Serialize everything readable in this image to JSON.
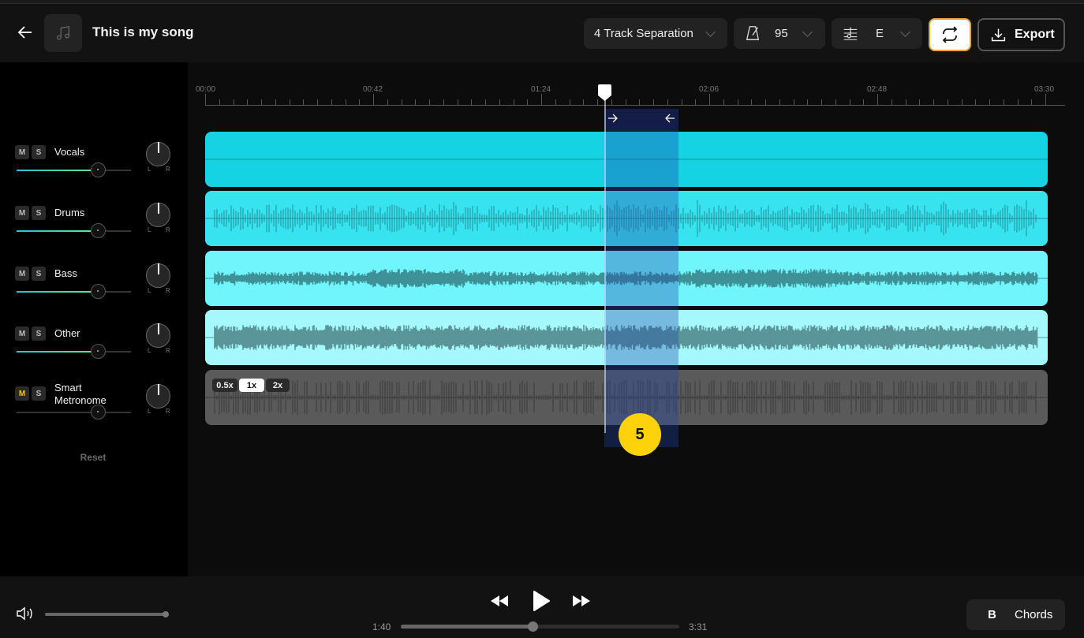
{
  "header": {
    "title": "This is my song",
    "separation": "4 Track Separation",
    "tempo": "95",
    "key": "E",
    "export_label": "Export"
  },
  "tracks": [
    {
      "name": "Vocals",
      "mute": "M",
      "solo": "S",
      "muted": false,
      "volume": 0.72,
      "pan": 0,
      "color": "#15d3e3",
      "wave": "#1a8f9c"
    },
    {
      "name": "Drums",
      "mute": "M",
      "solo": "S",
      "muted": false,
      "volume": 0.72,
      "pan": 0,
      "color": "#38e3f0",
      "wave": "#1f8f99"
    },
    {
      "name": "Bass",
      "mute": "M",
      "solo": "S",
      "muted": false,
      "volume": 0.72,
      "pan": 0,
      "color": "#6ff5fb",
      "wave": "#3f9198"
    },
    {
      "name": "Other",
      "mute": "M",
      "solo": "S",
      "muted": false,
      "volume": 0.72,
      "pan": 0,
      "color": "#a5f9fd",
      "wave": "#5a9699"
    },
    {
      "name": "Smart Metronome",
      "name_line1": "Smart",
      "name_line2": "Metronome",
      "mute": "M",
      "solo": "S",
      "muted": true,
      "volume": 0.72,
      "pan": 0,
      "color": "#5a5a5a",
      "wave": "#3a3a3a"
    }
  ],
  "pan_labels": {
    "left": "L",
    "right": "R"
  },
  "reset_label": "Reset",
  "metronome_speeds": [
    {
      "label": "0.5x",
      "active": false
    },
    {
      "label": "1x",
      "active": true
    },
    {
      "label": "2x",
      "active": false
    }
  ],
  "timeline": {
    "labels": [
      "00:00",
      "00:42",
      "01:24",
      "02:06",
      "02:48",
      "03:30"
    ],
    "total_seconds": 210,
    "playhead_seconds": 100,
    "loop_start_seconds": 100,
    "loop_end_seconds": 118.5
  },
  "loop_badge": "5",
  "footer": {
    "master_volume": 1.0,
    "current_time": "1:40",
    "total_time": "3:31",
    "progress": 0.474,
    "chord_key": "B",
    "chords_label": "Chords"
  }
}
